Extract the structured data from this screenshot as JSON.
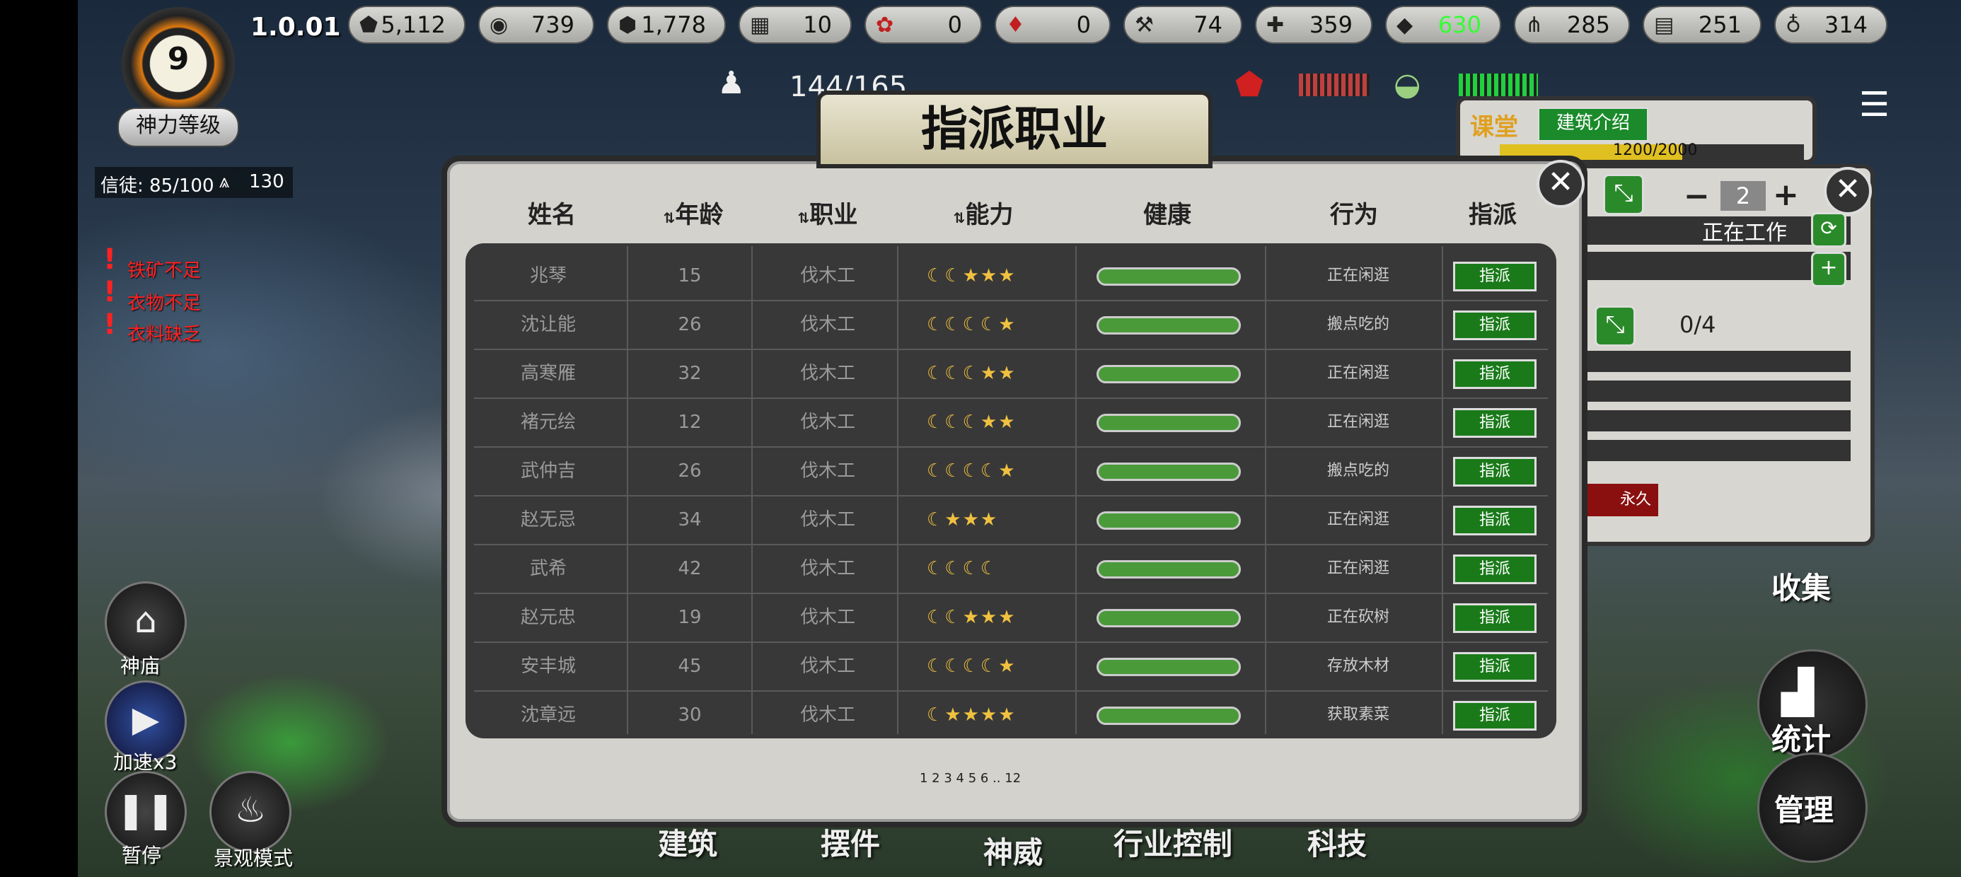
{
  "version": "1.0.01",
  "power_level": {
    "value": "9",
    "label": "神力等级"
  },
  "faith": {
    "text": "信徒: 85/100",
    "count": "130"
  },
  "resources": [
    {
      "icon": "stone-icon",
      "value": "5,112"
    },
    {
      "icon": "meat-icon",
      "value": "739"
    },
    {
      "icon": "wood-icon",
      "value": "1,778"
    },
    {
      "icon": "blocks-icon",
      "value": "10"
    },
    {
      "icon": "flower-icon",
      "value": "0"
    },
    {
      "icon": "cloth-icon",
      "value": "0"
    },
    {
      "icon": "hammer-icon",
      "value": "74"
    },
    {
      "icon": "herb-icon",
      "value": "359"
    },
    {
      "icon": "jade-icon",
      "value": "630"
    },
    {
      "icon": "grain-icon",
      "value": "285"
    },
    {
      "icon": "chest-icon",
      "value": "251"
    },
    {
      "icon": "bottle-icon",
      "value": "314"
    }
  ],
  "population": "144/165",
  "warnings": [
    "铁矿不足",
    "衣物不足",
    "衣料缺乏"
  ],
  "left_buttons": {
    "temple": "神庙",
    "speed": "加速x3",
    "pause": "暂停",
    "scenery": "景观模式"
  },
  "right_buttons": {
    "collect": "收集",
    "stats": "统计",
    "manage": "管理"
  },
  "bottom_nav": [
    "建筑",
    "摆件",
    "神威",
    "行业控制",
    "科技"
  ],
  "building_panel": {
    "name": "课堂",
    "intro_button": "建筑介绍",
    "progress": "1200/2000",
    "worker_count": "2",
    "status": "正在工作",
    "slots": "0/4",
    "permanent": "永久"
  },
  "dialog": {
    "title": "指派职业",
    "headers": {
      "name": "姓名",
      "age": "年龄",
      "job": "职业",
      "ability": "能力",
      "health": "健康",
      "action": "行为",
      "assign": "指派"
    },
    "rows": [
      {
        "name": "兆琴",
        "age": "15",
        "job": "伐木工",
        "ability": "☾☾★★★",
        "action": "正在闲逛",
        "assign": "指派"
      },
      {
        "name": "沈让能",
        "age": "26",
        "job": "伐木工",
        "ability": "☾☾☾☾★",
        "action": "搬点吃的",
        "assign": "指派"
      },
      {
        "name": "高寒雁",
        "age": "32",
        "job": "伐木工",
        "ability": "☾☾☾★★",
        "action": "正在闲逛",
        "assign": "指派"
      },
      {
        "name": "褚元绘",
        "age": "12",
        "job": "伐木工",
        "ability": "☾☾☾★★",
        "action": "正在闲逛",
        "assign": "指派"
      },
      {
        "name": "武仲吉",
        "age": "26",
        "job": "伐木工",
        "ability": "☾☾☾☾★",
        "action": "搬点吃的",
        "assign": "指派"
      },
      {
        "name": "赵无忌",
        "age": "34",
        "job": "伐木工",
        "ability": "☾★★★",
        "action": "正在闲逛",
        "assign": "指派"
      },
      {
        "name": "武希",
        "age": "42",
        "job": "伐木工",
        "ability": "☾☾☾☾",
        "action": "正在闲逛",
        "assign": "指派"
      },
      {
        "name": "赵元忠",
        "age": "19",
        "job": "伐木工",
        "ability": "☾☾★★★",
        "action": "正在砍树",
        "assign": "指派"
      },
      {
        "name": "安丰城",
        "age": "45",
        "job": "伐木工",
        "ability": "☾☾☾☾★",
        "action": "存放木材",
        "assign": "指派"
      },
      {
        "name": "沈章远",
        "age": "30",
        "job": "伐木工",
        "ability": "☾★★★★",
        "action": "获取素菜",
        "assign": "指派"
      }
    ],
    "pagination": "1 2 3 4 5 6 .. 12"
  },
  "colors": {
    "assign_green": "#1a7a1a",
    "health_green": "#4a9a3a",
    "jade_value": "#33ff33",
    "warning_red": "#ff2222"
  }
}
